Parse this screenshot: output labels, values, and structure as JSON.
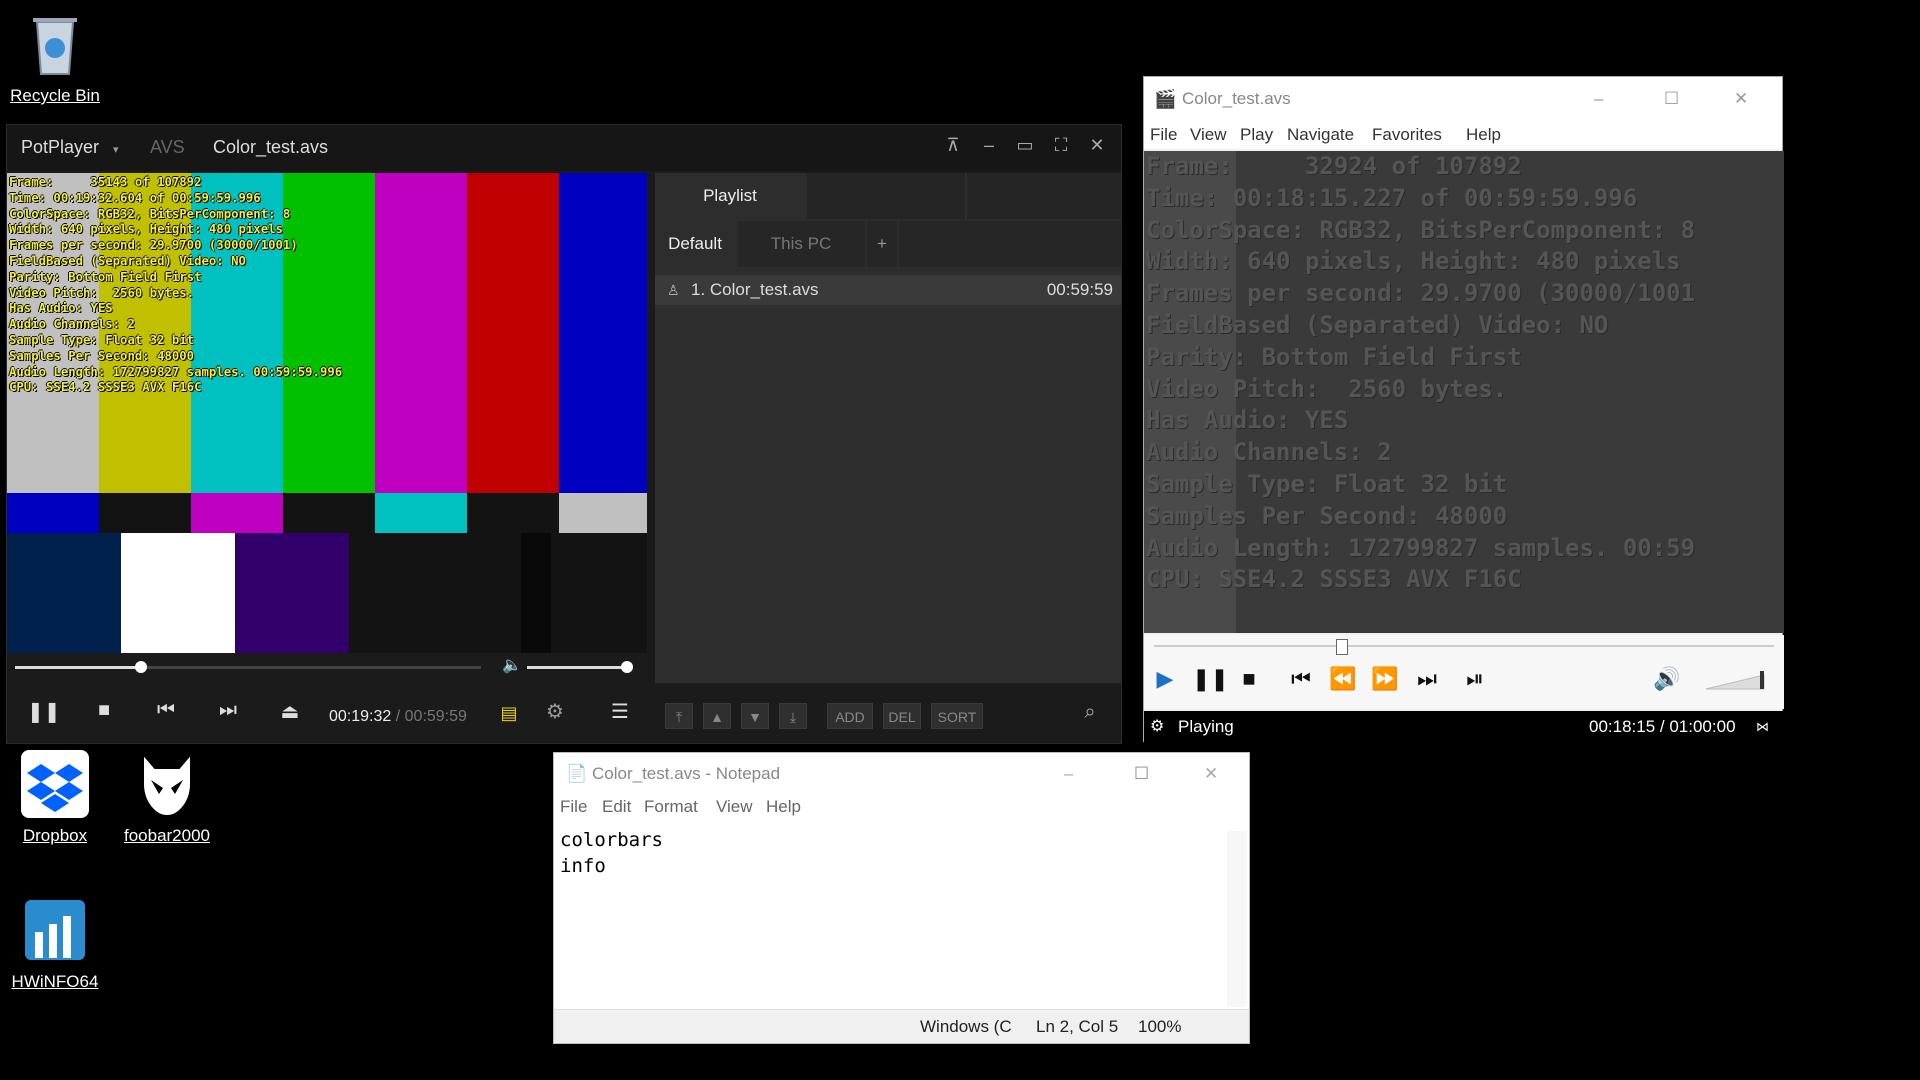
{
  "desktop": {
    "icons": [
      {
        "label": "Recycle Bin"
      },
      {
        "label": "Dropbox"
      },
      {
        "label": "foobar2000"
      },
      {
        "label": "HWiNFO64"
      }
    ]
  },
  "potplayer": {
    "app_name": "PotPlayer",
    "format_tag": "AVS",
    "file_title": "Color_test.avs",
    "osd_lines": [
      "Frame:     35143 of 107892",
      "Time: 00:19:32.604 of 00:59:59.996",
      "ColorSpace: RGB32, BitsPerComponent: 8",
      "Width: 640 pixels, Height: 480 pixels",
      "Frames per second: 29.9700 (30000/1001)",
      "FieldBased (Separated) Video: NO",
      "Parity: Bottom Field First",
      "Video Pitch:  2560 bytes.",
      "Has Audio: YES",
      "Audio Channels: 2",
      "Sample Type: Float 32 bit",
      "Samples Per Second: 48000",
      "Audio Length: 172799827 samples. 00:59:59.996",
      "CPU: SSE4.2 SSSE3 AVX F16C"
    ],
    "seek_fraction": 0.27,
    "volume_fraction": 1.0,
    "time_current": "00:19:32",
    "time_separator": "/",
    "time_total": "00:59:59",
    "playlist": {
      "tab_label": "Playlist",
      "sub_tabs": [
        "Default",
        "This PC",
        "+"
      ],
      "items": [
        {
          "label": "1. Color_test.avs",
          "duration": "00:59:59"
        }
      ],
      "buttons": [
        "ADD",
        "DEL",
        "SORT"
      ]
    }
  },
  "mpc": {
    "title": "Color_test.avs",
    "menu": [
      "File",
      "View",
      "Play",
      "Navigate",
      "Favorites",
      "Help"
    ],
    "osd_lines": [
      "Frame:     32924 of 107892",
      "Time: 00:18:15.227 of 00:59:59.996",
      "ColorSpace: RGB32, BitsPerComponent: 8",
      "Width: 640 pixels, Height: 480 pixels",
      "Frames per second: 29.9700 (30000/1001",
      "FieldBased (Separated) Video: NO",
      "Parity: Bottom Field First",
      "Video Pitch:  2560 bytes.",
      "Has Audio: YES",
      "Audio Channels: 2",
      "Sample Type: Float 32 bit",
      "Samples Per Second: 48000",
      "Audio Length: 172799827 samples. 00:59",
      "CPU: SSE4.2 SSSE3 AVX F16C"
    ],
    "seek_fraction": 0.304,
    "status": "Playing",
    "time": "00:18:15 / 01:00:00"
  },
  "notepad": {
    "title": "Color_test.avs - Notepad",
    "menu": [
      "File",
      "Edit",
      "Format",
      "View",
      "Help"
    ],
    "lines": [
      "colorbars",
      "info"
    ],
    "status": {
      "encoding": "Windows (C",
      "position": "Ln 2, Col 5",
      "zoom": "100%"
    }
  }
}
